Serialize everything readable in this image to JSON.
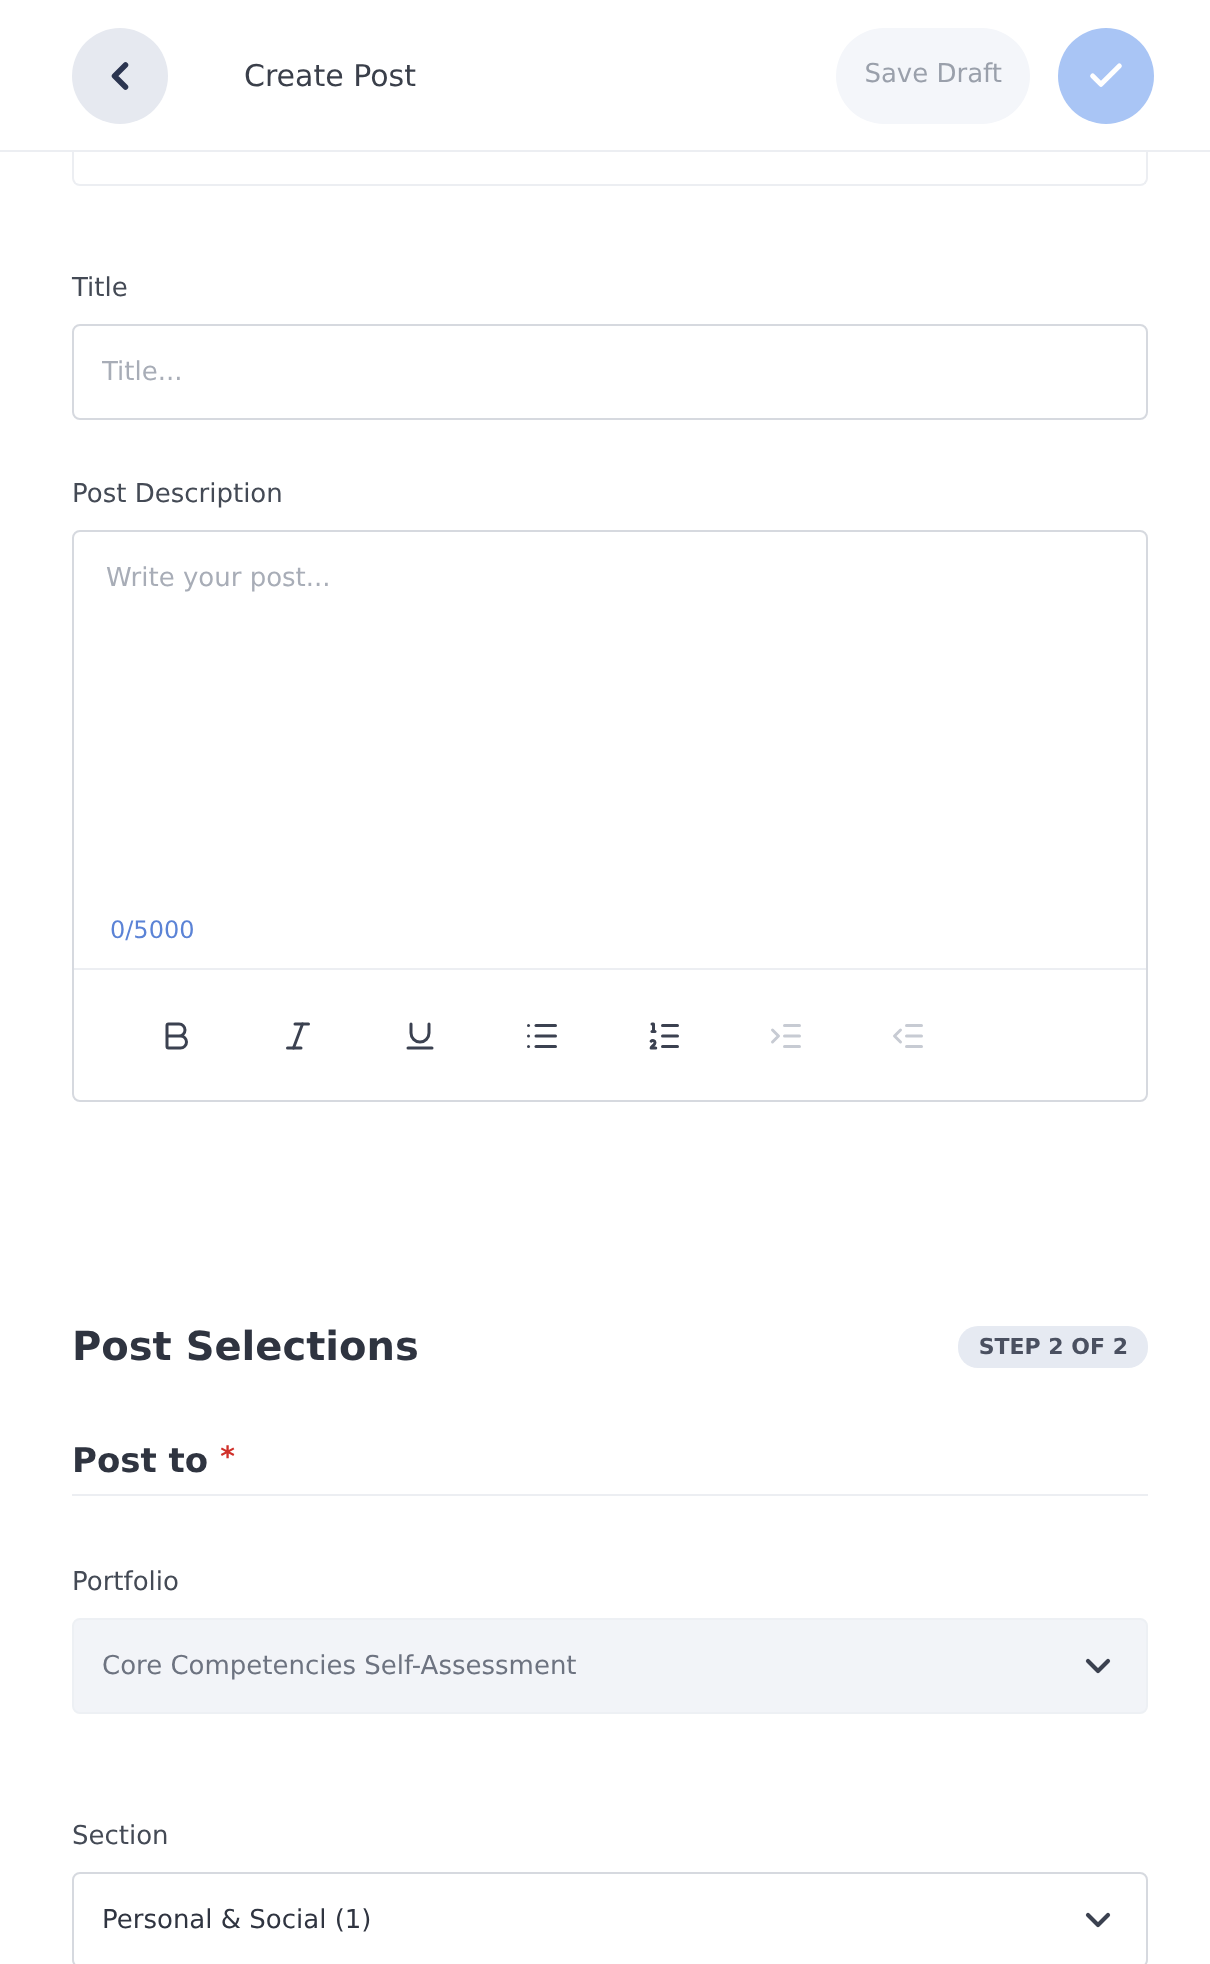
{
  "header": {
    "title": "Create Post",
    "save_button": {
      "label": "Save Draft",
      "disabled": true
    },
    "submit_button": {
      "disabled": true
    }
  },
  "title_field": {
    "label": "Title",
    "placeholder": "Title..."
  },
  "description": {
    "label": "Post Description",
    "placeholder": "Write your post...",
    "counter": "0/5000",
    "toolbar": [
      {
        "kind": "bold",
        "disabled": false
      },
      {
        "kind": "italic",
        "disabled": false
      },
      {
        "kind": "underline",
        "disabled": false
      },
      {
        "kind": "bullets",
        "disabled": false
      },
      {
        "kind": "numbers",
        "disabled": false
      },
      {
        "kind": "indent",
        "disabled": true
      },
      {
        "kind": "outdent",
        "disabled": true
      }
    ]
  },
  "post_selections": {
    "heading": "Post Selections",
    "step": "STEP 2 OF 2",
    "post_to": {
      "label": "Post to",
      "required_mark": "*"
    },
    "fields": [
      {
        "label": "Portfolio",
        "value": "Core Competencies Self-Assessment",
        "disabled": true
      },
      {
        "label": "Section",
        "value": "Personal & Social (1)",
        "disabled": false
      }
    ]
  }
}
